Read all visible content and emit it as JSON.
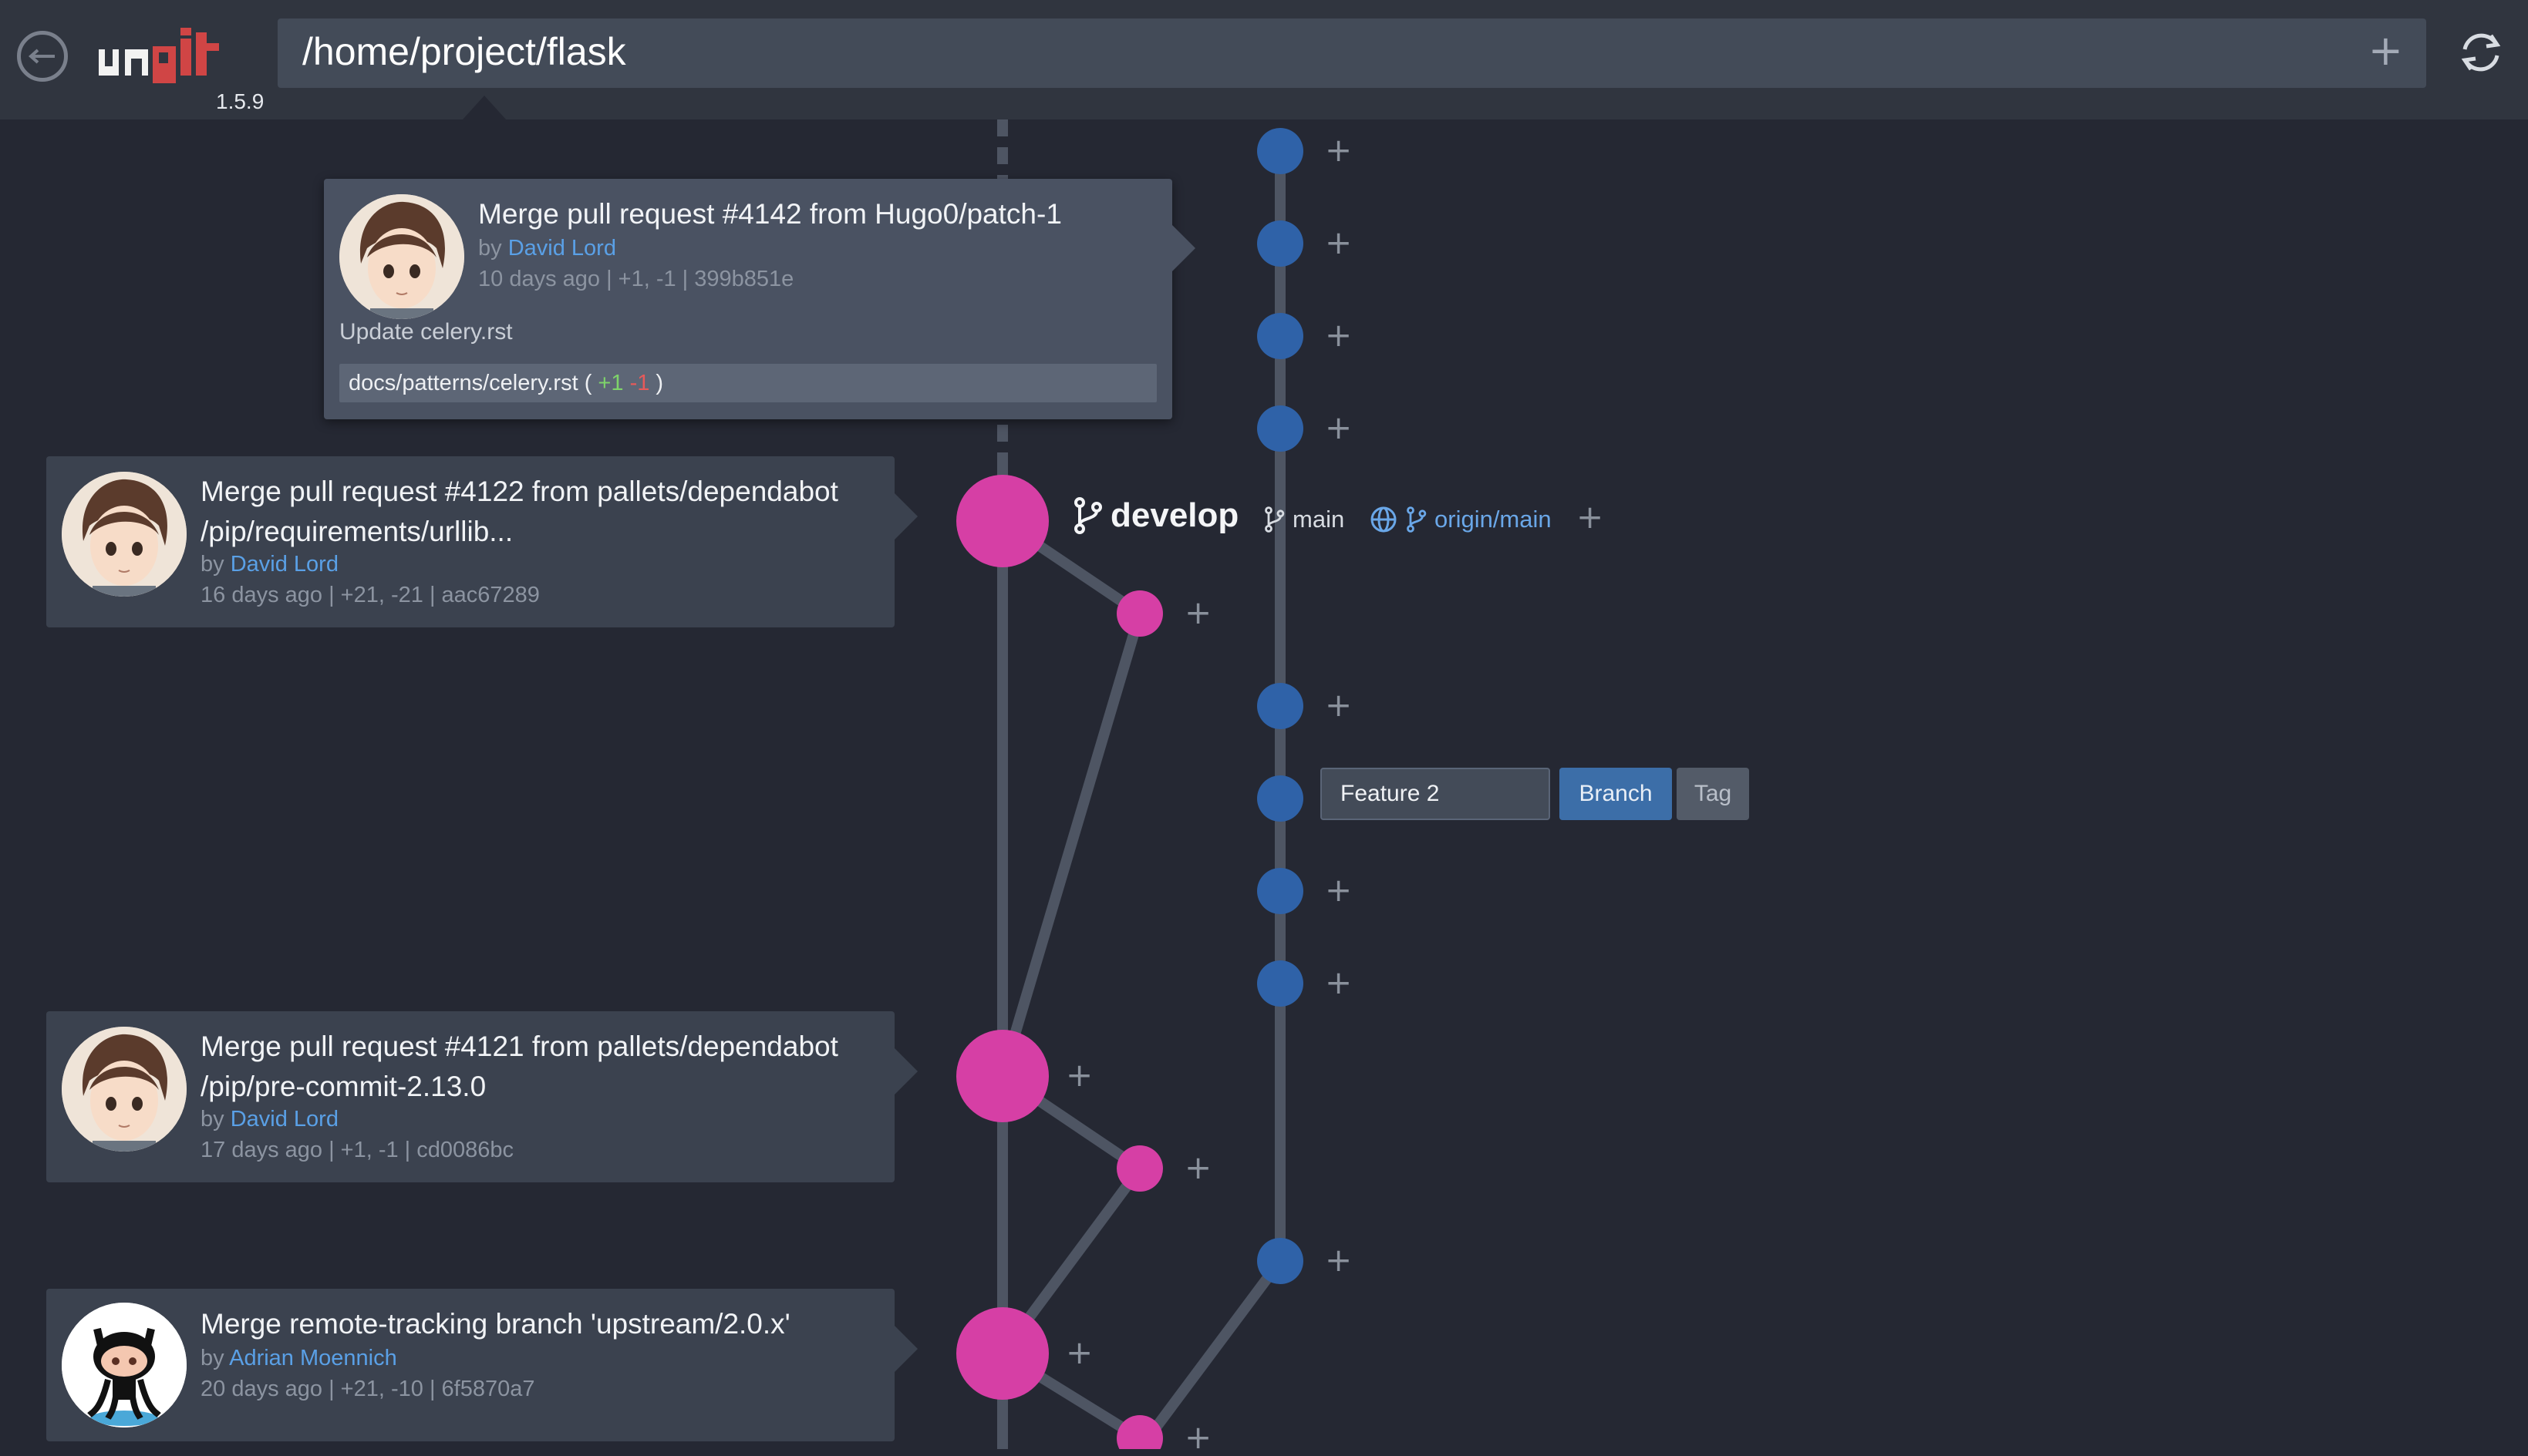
{
  "app": {
    "version": "1.5.9",
    "path": "/home/project/flask",
    "path_add_label": "+",
    "logo_text": "ungit"
  },
  "colors": {
    "background": "#252833",
    "header": "#30353f",
    "card": "#3b424f",
    "develop_branch": "#d63fa5",
    "main_branch": "#2f62a8",
    "link": "#5aa0e6"
  },
  "popup_commit": {
    "title": "Merge pull request #4142 from Hugo0/patch-1",
    "by_label": "by",
    "author": "David Lord",
    "meta": "10 days ago | +1, -1 | 399b851e",
    "body": "Update celery.rst",
    "file": {
      "path": "docs/patterns/celery.rst",
      "open": " ( ",
      "additions": "+1",
      "deletions": "-1",
      "close": " )"
    }
  },
  "commits": [
    {
      "title_line1": "Merge pull request #4122 from pallets/dependabot",
      "title_line2": "/pip/requirements/urllib...",
      "by_label": "by",
      "author": "David Lord",
      "meta": "16 days ago | +21, -21 | aac67289"
    },
    {
      "title_line1": "Merge pull request #4121 from pallets/dependabot",
      "title_line2": "/pip/pre-commit-2.13.0",
      "by_label": "by",
      "author": "David Lord",
      "meta": "17 days ago | +1, -1 | cd0086bc"
    },
    {
      "title_line1": "Merge remote-tracking branch 'upstream/2.0.x'",
      "by_label": "by",
      "author": "Adrian Moennich",
      "meta": "20 days ago | +21, -10 | 6f5870a7"
    }
  ],
  "refs": {
    "develop": "develop",
    "main": "main",
    "origin_main": "origin/main",
    "add": "+"
  },
  "new_ref": {
    "value": "Feature 2",
    "branch_label": "Branch",
    "tag_label": "Tag"
  },
  "plus_symbol": "+"
}
